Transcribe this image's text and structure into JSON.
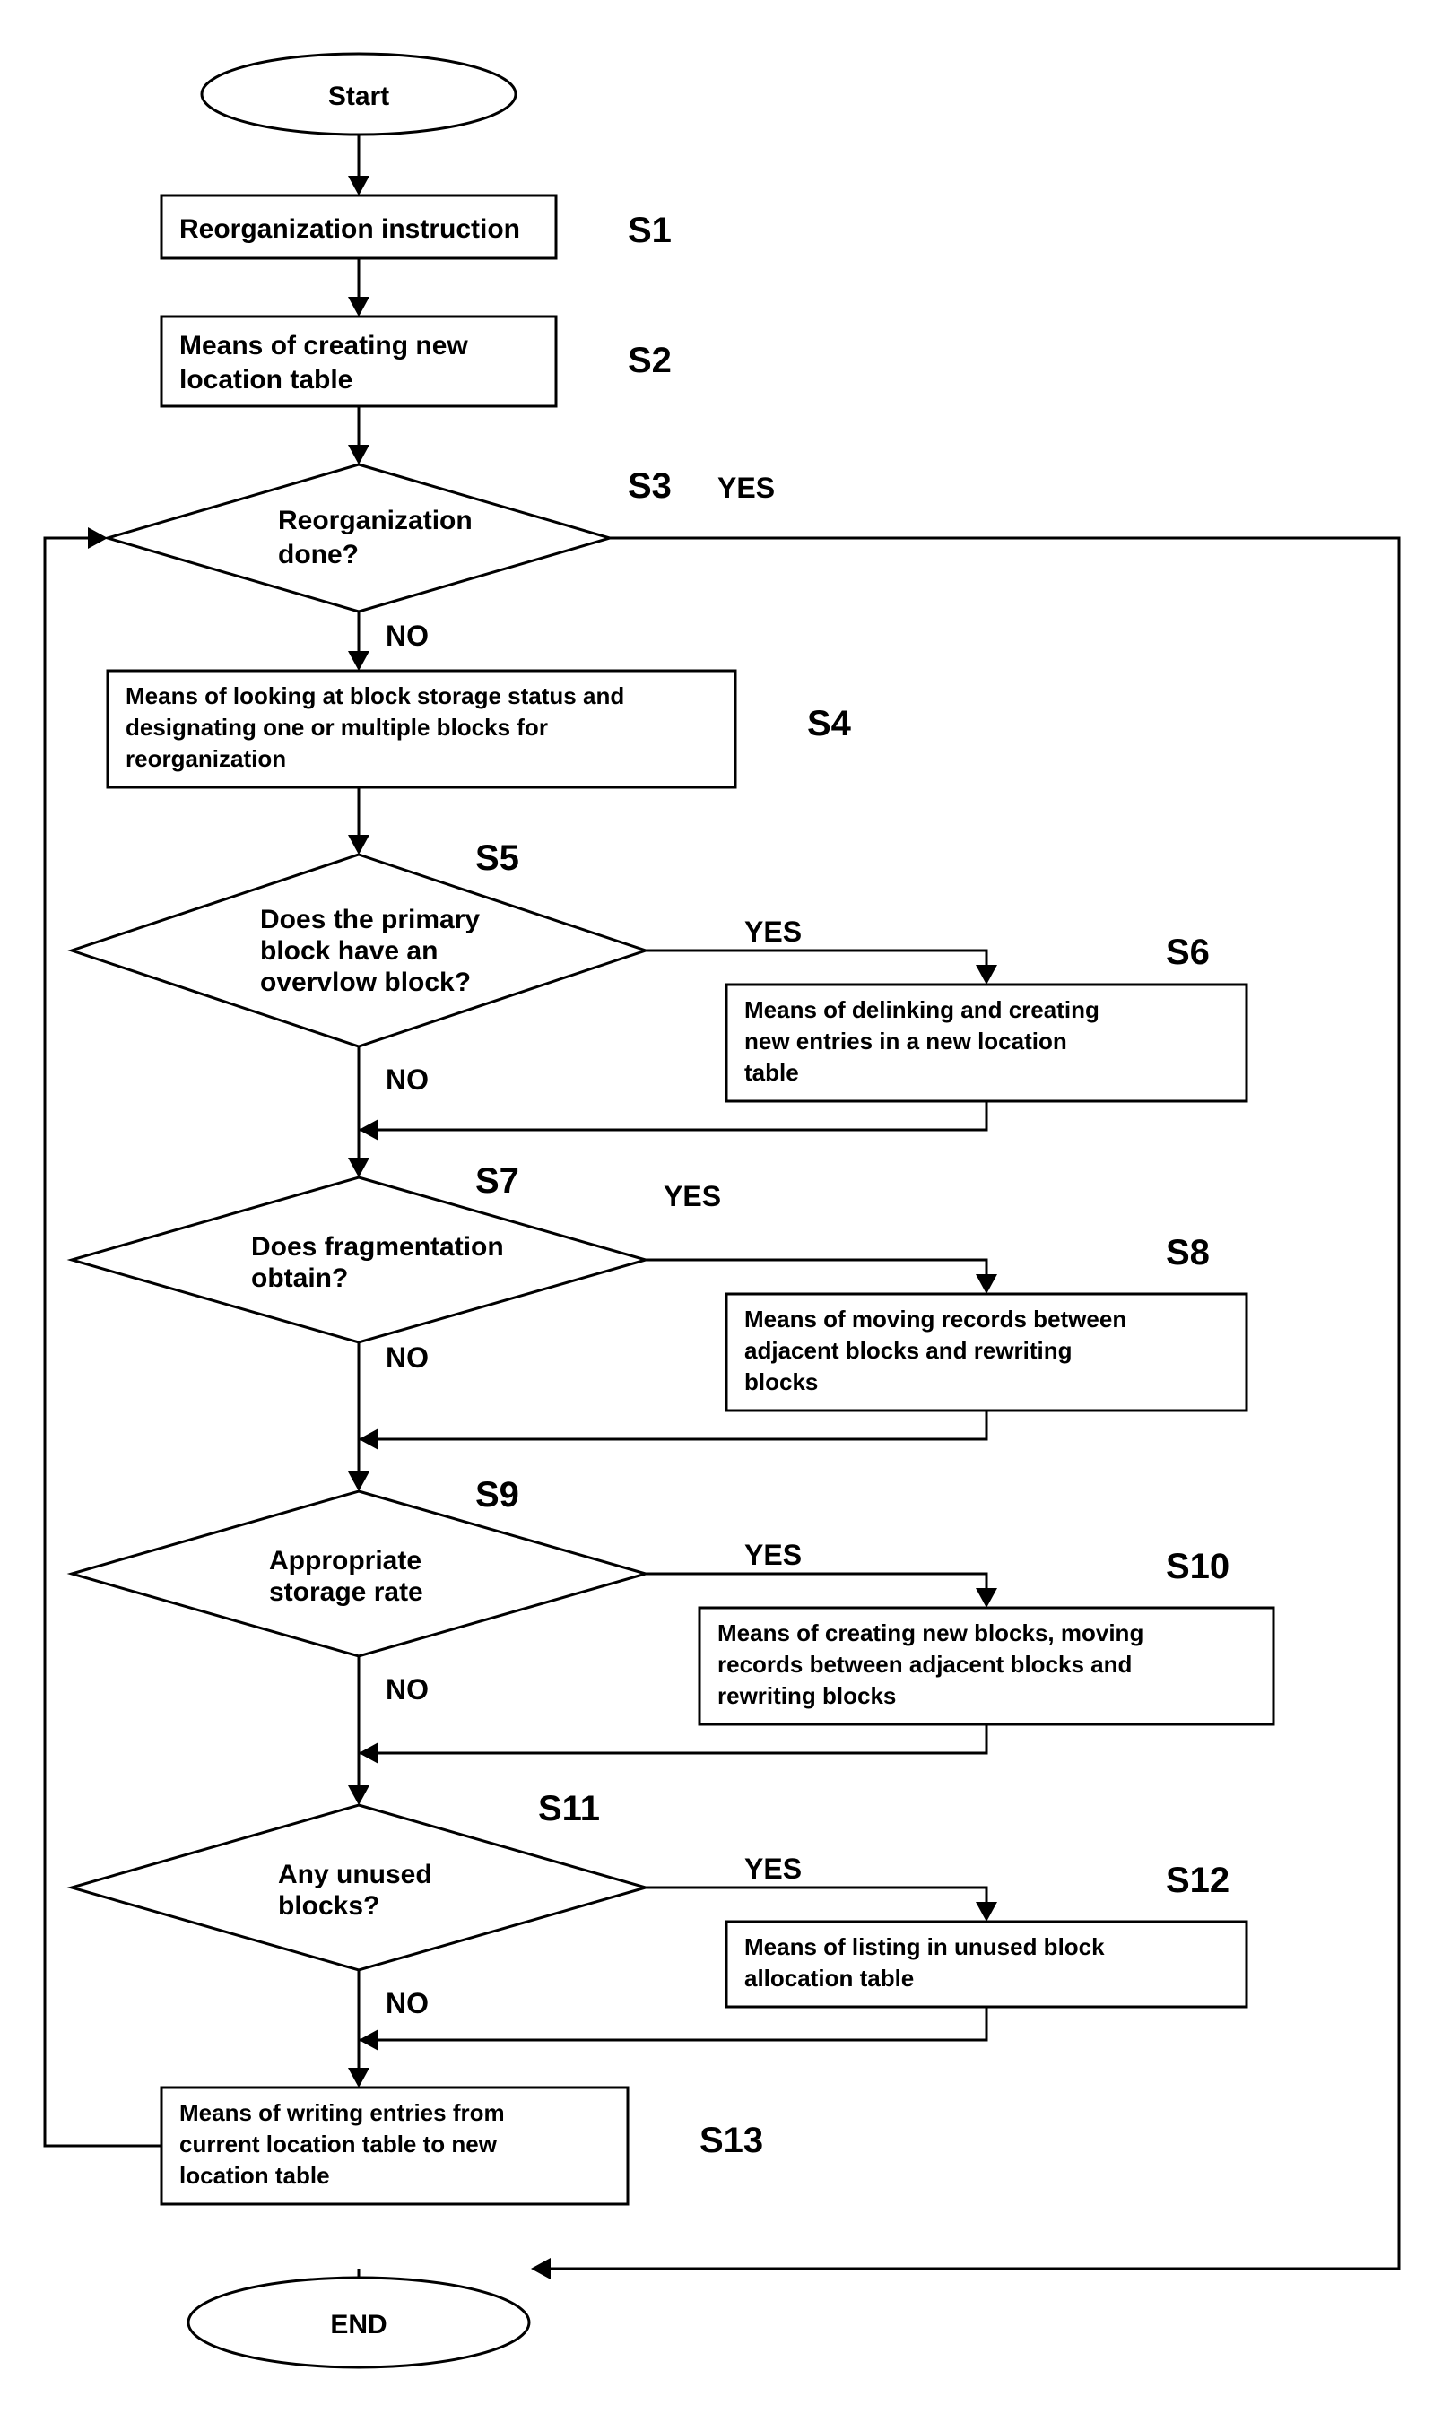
{
  "chart_data": {
    "type": "flowchart",
    "nodes": [
      {
        "id": "start",
        "kind": "terminal",
        "text": "Start"
      },
      {
        "id": "s1",
        "kind": "process",
        "text": "Reorganization instruction",
        "step": "S1"
      },
      {
        "id": "s2",
        "kind": "process",
        "text": "Means of creating new location table",
        "step": "S2"
      },
      {
        "id": "s3",
        "kind": "decision",
        "text": "Reorganization done?",
        "step": "S3"
      },
      {
        "id": "s4",
        "kind": "process",
        "text": "Means of looking at block storage status and designating one or multiple blocks for reorganization",
        "step": "S4"
      },
      {
        "id": "s5",
        "kind": "decision",
        "text": "Does the primary block have an overvlow block?",
        "step": "S5"
      },
      {
        "id": "s6",
        "kind": "process",
        "text": "Means of delinking and creating new entries in a new location table",
        "step": "S6"
      },
      {
        "id": "s7",
        "kind": "decision",
        "text": "Does fragmentation obtain?",
        "step": "S7"
      },
      {
        "id": "s8",
        "kind": "process",
        "text": "Means of moving records between adjacent blocks and rewriting blocks",
        "step": "S8"
      },
      {
        "id": "s9",
        "kind": "decision",
        "text": "Appropriate storage rate",
        "step": "S9"
      },
      {
        "id": "s10",
        "kind": "process",
        "text": "Means of creating new blocks, moving records between adjacent blocks and rewriting blocks",
        "step": "S10"
      },
      {
        "id": "s11",
        "kind": "decision",
        "text": "Any unused blocks?",
        "step": "S11"
      },
      {
        "id": "s12",
        "kind": "process",
        "text": "Means of listing in unused block allocation table",
        "step": "S12"
      },
      {
        "id": "s13",
        "kind": "process",
        "text": "Means of writing entries from current location table to new location table",
        "step": "S13"
      },
      {
        "id": "end",
        "kind": "terminal",
        "text": "END"
      }
    ],
    "edges": [
      {
        "from": "start",
        "to": "s1"
      },
      {
        "from": "s1",
        "to": "s2"
      },
      {
        "from": "s2",
        "to": "s3"
      },
      {
        "from": "s3",
        "to": "s4",
        "label": "NO"
      },
      {
        "from": "s3",
        "to": "end",
        "label": "YES"
      },
      {
        "from": "s4",
        "to": "s5"
      },
      {
        "from": "s5",
        "to": "s6",
        "label": "YES"
      },
      {
        "from": "s5",
        "to": "s7_merge",
        "label": "NO"
      },
      {
        "from": "s6",
        "to": "s7_merge"
      },
      {
        "from": "s7",
        "to": "s8",
        "label": "YES"
      },
      {
        "from": "s7",
        "to": "s9_merge",
        "label": "NO"
      },
      {
        "from": "s8",
        "to": "s9_merge"
      },
      {
        "from": "s9",
        "to": "s10",
        "label": "YES"
      },
      {
        "from": "s9",
        "to": "s11_merge",
        "label": "NO"
      },
      {
        "from": "s10",
        "to": "s11_merge"
      },
      {
        "from": "s11",
        "to": "s12",
        "label": "YES"
      },
      {
        "from": "s11",
        "to": "s13_merge",
        "label": "NO"
      },
      {
        "from": "s12",
        "to": "s13_merge"
      },
      {
        "from": "s13",
        "to": "s3",
        "kind": "loop-back"
      }
    ],
    "labels": {
      "yes": "YES",
      "no": "NO"
    }
  },
  "start": "Start",
  "end": "END",
  "s1": {
    "step": "S1",
    "text": "Reorganization instruction"
  },
  "s2": {
    "step": "S2",
    "l1": "Means of creating new",
    "l2": "location table"
  },
  "s3": {
    "step": "S3",
    "l1": "Reorganization",
    "l2": "done?"
  },
  "s4": {
    "step": "S4",
    "l1": "Means of looking at block storage status and",
    "l2": "designating one or multiple blocks for",
    "l3": "reorganization"
  },
  "s5": {
    "step": "S5",
    "l1": "Does the primary",
    "l2": "block have an",
    "l3": "overvlow block?"
  },
  "s6": {
    "step": "S6",
    "l1": "Means of delinking and creating",
    "l2": "new entries in a new location",
    "l3": "table"
  },
  "s7": {
    "step": "S7",
    "l1": "Does fragmentation",
    "l2": "obtain?"
  },
  "s8": {
    "step": "S8",
    "l1": "Means of moving records between",
    "l2": "adjacent blocks and rewriting",
    "l3": "blocks"
  },
  "s9": {
    "step": "S9",
    "l1": "Appropriate",
    "l2": "storage rate"
  },
  "s10": {
    "step": "S10",
    "l1": "Means of creating new blocks, moving",
    "l2": "records between adjacent blocks and",
    "l3": "rewriting blocks"
  },
  "s11": {
    "step": "S11",
    "l1": "Any unused",
    "l2": "blocks?"
  },
  "s12": {
    "step": "S12",
    "l1": "Means of listing in unused block",
    "l2": "allocation table"
  },
  "s13": {
    "step": "S13",
    "l1": "Means of writing entries from",
    "l2": "current location table to new",
    "l3": "location table"
  },
  "yes": "YES",
  "no": "NO"
}
